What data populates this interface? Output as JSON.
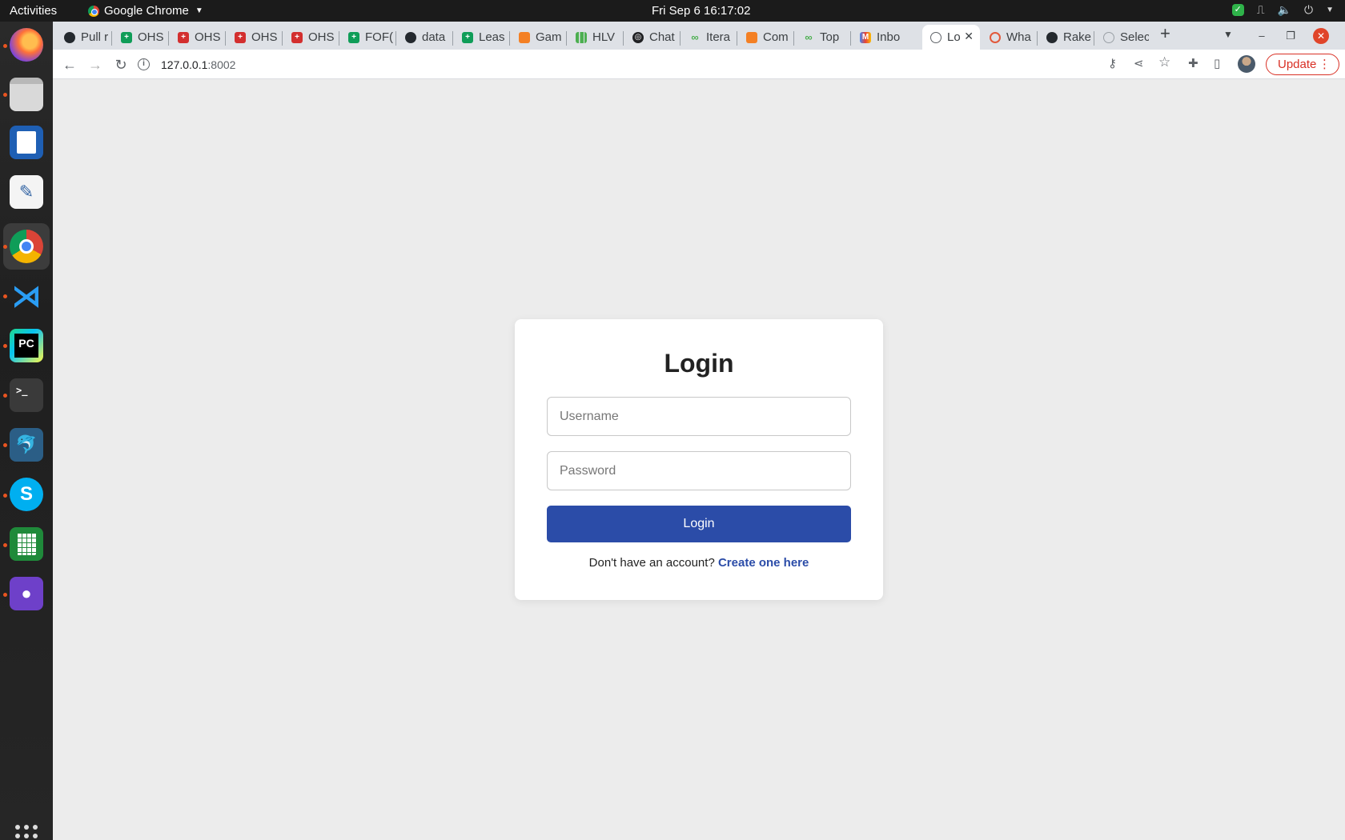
{
  "topbar": {
    "activities": "Activities",
    "app_name": "Google Chrome",
    "clock": "Fri Sep 6  16:17:02"
  },
  "dock": {
    "items": [
      {
        "name": "firefox-icon"
      },
      {
        "name": "files-icon"
      },
      {
        "name": "writer-icon"
      },
      {
        "name": "text-editor-icon"
      },
      {
        "name": "chrome-icon"
      },
      {
        "name": "vscode-icon"
      },
      {
        "name": "pycharm-icon",
        "glyph": "PC"
      },
      {
        "name": "terminal-icon",
        "glyph": ">_"
      },
      {
        "name": "mysql-workbench-icon"
      },
      {
        "name": "skype-icon",
        "glyph": "S"
      },
      {
        "name": "calc-icon"
      },
      {
        "name": "github-desktop-icon"
      }
    ]
  },
  "tabs": [
    {
      "label": "Pull r",
      "favicon": "github"
    },
    {
      "label": "OHS",
      "favicon": "sheets"
    },
    {
      "label": "OHS",
      "favicon": "red"
    },
    {
      "label": "OHS",
      "favicon": "red"
    },
    {
      "label": "OHS",
      "favicon": "red"
    },
    {
      "label": "FOF(",
      "favicon": "sheets"
    },
    {
      "label": "data",
      "favicon": "github"
    },
    {
      "label": "Leas",
      "favicon": "sheets"
    },
    {
      "label": "Gam",
      "favicon": "orange"
    },
    {
      "label": "HLV",
      "favicon": "chart"
    },
    {
      "label": "Chat",
      "favicon": "openai"
    },
    {
      "label": "Itera",
      "favicon": "link"
    },
    {
      "label": "Com",
      "favicon": "orange"
    },
    {
      "label": "Top",
      "favicon": "link"
    },
    {
      "label": "Inbo",
      "favicon": "gmail"
    },
    {
      "label": "Lo",
      "favicon": "globe",
      "active": true
    },
    {
      "label": "Wha",
      "favicon": "red-circle"
    },
    {
      "label": "Rake",
      "favicon": "github"
    },
    {
      "label": "Selec",
      "favicon": "globe"
    }
  ],
  "toolbar": {
    "url_host": "127.0.0.1",
    "url_port": ":8002",
    "update_label": "Update"
  },
  "login": {
    "title": "Login",
    "username_placeholder": "Username",
    "password_placeholder": "Password",
    "button_label": "Login",
    "signup_prompt": "Don't have an account?",
    "signup_link": "Create one here"
  },
  "colors": {
    "accent": "#2b4ca8",
    "page_bg": "#ececec",
    "update_red": "#d93025"
  }
}
